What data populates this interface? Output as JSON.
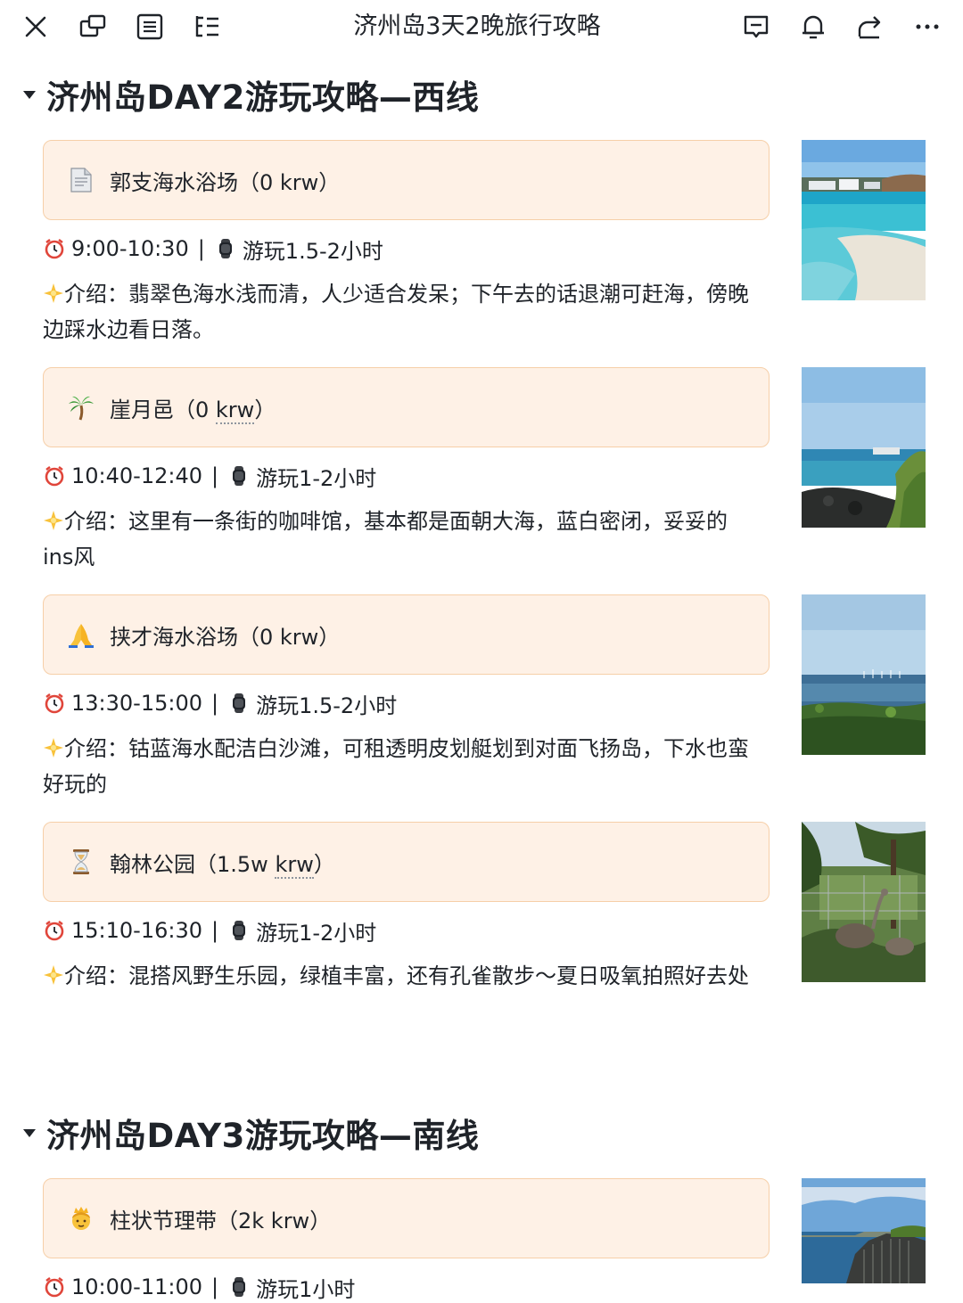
{
  "topbar": {
    "title": "济州岛3天2晚旅行攻略",
    "left_icons": [
      "close-icon",
      "new-window-icon",
      "document-outline-icon",
      "list-tree-icon"
    ],
    "right_icons": [
      "comment-icon",
      "bell-icon",
      "share-icon",
      "more-icon"
    ]
  },
  "sections": [
    {
      "title": "济州岛DAY2游玩攻略—西线",
      "spots": [
        {
          "icon": "document-icon",
          "name": "郭支海水浴场（0 krw）",
          "time": "9:00-10:30",
          "duration": "游玩1.5-2小时",
          "intro": "介绍：翡翠色海水浅而清，人少适合发呆；下午去的话退潮可赶海，傍晚边踩水边看日落。",
          "photo": "beach-photo"
        },
        {
          "icon": "palm-tree-icon",
          "name_main": "崖月邑（0 ",
          "name_dotted": "krw",
          "name_end": "）",
          "time": "10:40-12:40",
          "duration": "游玩1-2小时",
          "intro": "介绍：这里有一条街的咖啡馆，基本都是面朝大海，蓝白密闭，妥妥的ins风",
          "photo": "coast-photo"
        },
        {
          "icon": "pray-hands-icon",
          "name": "挟才海水浴场（0 krw）",
          "time": "13:30-15:00",
          "duration": "游玩1.5-2小时",
          "intro": "介绍：钴蓝海水配洁白沙滩，可租透明皮划艇划到对面飞扬岛，下水也蛮好玩的",
          "photo": "sea-photo"
        },
        {
          "icon": "hourglass-icon",
          "name_main": "翰林公园（1.5w ",
          "name_dotted": "krw",
          "name_end": "）",
          "time": "15:10-16:30",
          "duration": "游玩1-2小时",
          "intro": "介绍：混搭风野生乐园，绿植丰富，还有孔雀散步～夏日吸氧拍照好去处",
          "photo": "park-photo"
        }
      ]
    },
    {
      "title": "济州岛DAY3游玩攻略—南线",
      "spots": [
        {
          "icon": "princess-icon",
          "name": "柱状节理带（2k krw）",
          "time": "10:00-11:00",
          "duration": "游玩1小时",
          "photo": "cliff-photo"
        }
      ]
    }
  ],
  "colors": {
    "card_bg": "#fef1e6",
    "card_border": "#f6cfa8",
    "text": "#1f2329"
  }
}
